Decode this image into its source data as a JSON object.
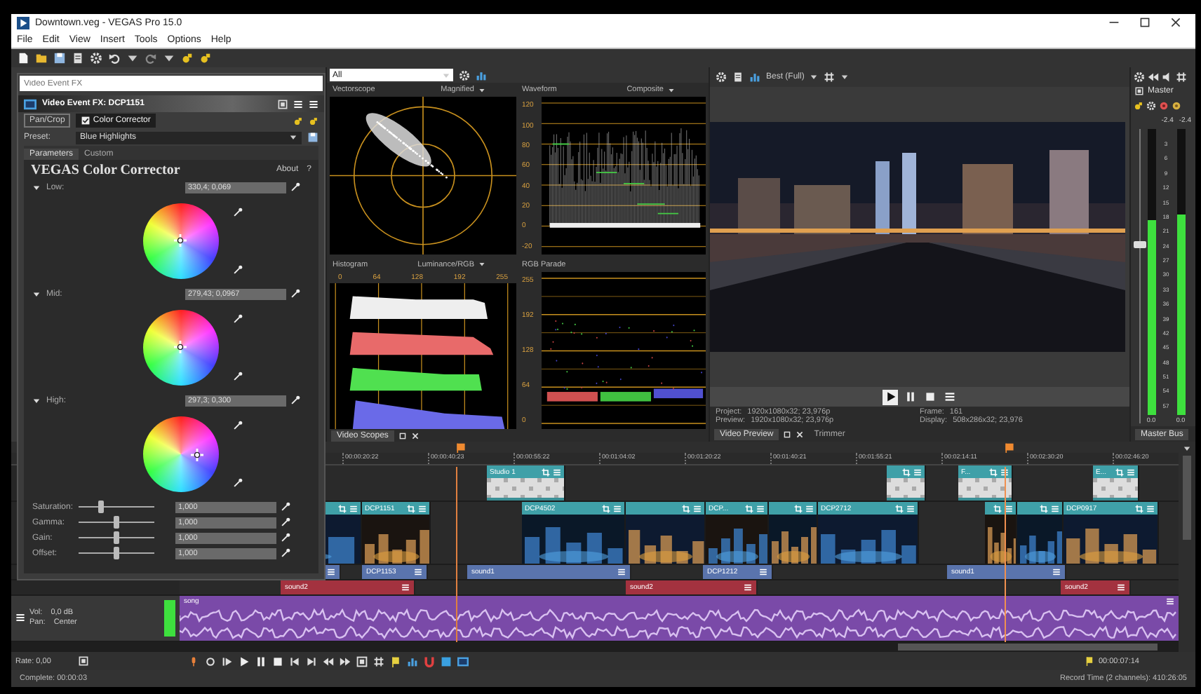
{
  "window": {
    "title": "Downtown.veg - VEGAS Pro 15.0"
  },
  "menu": [
    "File",
    "Edit",
    "View",
    "Insert",
    "Tools",
    "Options",
    "Help"
  ],
  "fx_panel": {
    "search": {
      "placeholder": "Video Event FX"
    },
    "title": "Video Event FX: DCP1151",
    "chain": [
      {
        "label": "Pan/Crop",
        "selected": false
      },
      {
        "label": "Color Corrector",
        "selected": true
      }
    ],
    "preset_label": "Preset:",
    "preset": "Blue Highlights",
    "tabs": [
      {
        "label": "Parameters",
        "selected": true
      },
      {
        "label": "Custom",
        "selected": false
      }
    ],
    "plugin_title": "VEGAS Color Corrector",
    "about": "About",
    "help": "?",
    "wheels": [
      {
        "label": "Low:",
        "value": "330,4; 0,069"
      },
      {
        "label": "Mid:",
        "value": "279,43; 0,0967"
      },
      {
        "label": "High:",
        "value": "297,3; 0,300"
      }
    ],
    "sliders": [
      {
        "label": "Saturation:",
        "value": "1,000",
        "level": 0.3
      },
      {
        "label": "Gamma:",
        "value": "1,000",
        "level": 0.5
      },
      {
        "label": "Gain:",
        "value": "1,000",
        "level": 0.5
      },
      {
        "label": "Offset:",
        "value": "1,000",
        "level": 0.5
      }
    ]
  },
  "scopes": {
    "source": "All",
    "panels": [
      {
        "kind": "vectorscope",
        "title": "Vectorscope",
        "mode": "Magnified"
      },
      {
        "kind": "waveform",
        "title": "Waveform",
        "mode": "Composite",
        "scale": [
          "120",
          "100",
          "80",
          "60",
          "40",
          "20",
          "0",
          "-20"
        ]
      },
      {
        "kind": "histogram",
        "title": "Histogram",
        "mode": "Luminance/RGB",
        "scale": [
          "0",
          "64",
          "128",
          "192",
          "255"
        ]
      },
      {
        "kind": "parade",
        "title": "RGB Parade",
        "scale": [
          "255",
          "192",
          "128",
          "64",
          "0"
        ]
      }
    ],
    "tab": "Video Scopes"
  },
  "preview": {
    "quality": "Best (Full)",
    "info": [
      {
        "label": "Project:",
        "value": "1920x1080x32; 23,976p"
      },
      {
        "label": "Frame:",
        "value": "161"
      },
      {
        "label": "Preview:",
        "value": "1920x1080x32; 23,976p"
      },
      {
        "label": "Display:",
        "value": "508x286x32; 23,976"
      }
    ],
    "tabs": [
      {
        "label": "Video Preview",
        "selected": true
      },
      {
        "label": "Trimmer",
        "selected": false
      }
    ]
  },
  "master": {
    "title": "Master",
    "peaks": [
      "-2.4",
      "-2.4"
    ],
    "scale": [
      "3",
      "6",
      "9",
      "12",
      "15",
      "18",
      "21",
      "24",
      "27",
      "30",
      "33",
      "36",
      "39",
      "42",
      "45",
      "48",
      "51",
      "54",
      "57"
    ],
    "fader": {
      "level": 0.62
    },
    "meters": [
      {
        "level": 0.68,
        "reading": "0.0"
      },
      {
        "level": 0.7,
        "reading": "0.0"
      }
    ],
    "tab": "Master Bus"
  },
  "timeline": {
    "ruler": [
      "00:00:20:22",
      "00:00:40:23",
      "00:00:55:22",
      "00:01:04:02",
      "00:01:20:22",
      "00:01:40:21",
      "00:01:55:21",
      "00:02:14:11",
      "00:02:30:20",
      "00:02:46:20"
    ],
    "tracks": [
      {
        "clips": [
          {
            "kind": "overlay",
            "name": "Studio 1"
          },
          {
            "kind": "overlay"
          },
          {
            "kind": "overlay",
            "name": "F..."
          },
          {
            "kind": "overlay",
            "name": "E..."
          }
        ]
      },
      {
        "clips": [
          {
            "kind": "video"
          },
          {
            "kind": "video",
            "name": "DCP1151"
          },
          {
            "kind": "video",
            "name": "DCP4502"
          },
          {
            "kind": "video"
          },
          {
            "kind": "video",
            "name": "DCP..."
          },
          {
            "kind": "video"
          },
          {
            "kind": "video",
            "name": "DCP2712"
          },
          {
            "kind": "video"
          },
          {
            "kind": "video"
          },
          {
            "kind": "video",
            "name": "DCP0917"
          }
        ]
      },
      {
        "color": "#5a74ad",
        "clips": [
          {
            "kind": "bar"
          },
          {
            "kind": "bar",
            "name": "DCP1153"
          },
          {
            "kind": "bar",
            "name": "sound1"
          },
          {
            "kind": "bar",
            "name": "DCP1212"
          },
          {
            "kind": "bar",
            "name": "sound1"
          }
        ]
      },
      {
        "color": "#a3323f",
        "clips": [
          {
            "kind": "bar",
            "name": "sound2"
          },
          {
            "kind": "bar",
            "name": "sound2"
          },
          {
            "kind": "bar",
            "name": "sound2"
          }
        ]
      },
      {
        "color": "#7a4aa8",
        "clips": [
          {
            "kind": "audio",
            "name": "song"
          }
        ],
        "header": {
          "vol_label": "Vol:",
          "vol": "0,0 dB",
          "pan_label": "Pan:",
          "pan": "Center"
        }
      }
    ],
    "rate": "Rate: 0,00",
    "time": "00:00:07:14"
  },
  "status_bar": {
    "left": "Complete: 00:00:03",
    "right": "Record Time (2 channels): 410:26:05"
  }
}
